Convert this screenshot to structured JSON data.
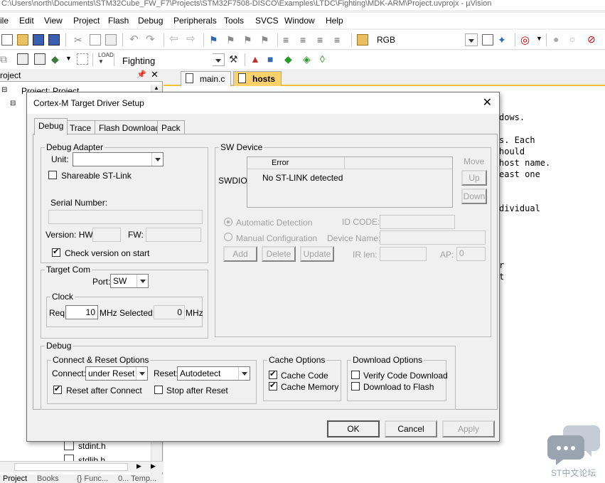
{
  "window": {
    "title": "C:\\Users\\north\\Documents\\STM32Cube_FW_F7\\Projects\\STM32F7508-DISCO\\Examples\\LTDC\\Fighting\\MDK-ARM\\Project.uvprojx - µVision"
  },
  "menu": [
    "ile",
    "Edit",
    "View",
    "Project",
    "Flash",
    "Debug",
    "Peripherals",
    "Tools",
    "SVCS",
    "Window",
    "Help"
  ],
  "toolbar": {
    "rgb_label": "RGB",
    "target_value": "Fighting"
  },
  "project_panel": {
    "title": "roject",
    "root": "Project: Project",
    "files": [
      "stdint.h",
      "stdlib.h"
    ],
    "bottom_tabs": [
      "Project",
      "Books",
      "{} Func...",
      "0... Temp..."
    ]
  },
  "editor": {
    "tabs": [
      "main.c",
      "hosts"
    ],
    "lines": [
      "dows.",
      "s. Each",
      "hould",
      "host name.",
      "east one",
      "dividual",
      "r",
      "t"
    ]
  },
  "dialog": {
    "title": "Cortex-M Target Driver Setup",
    "tabs": [
      "Debug",
      "Trace",
      "Flash Download",
      "Pack"
    ],
    "debug_adapter": {
      "legend": "Debug Adapter",
      "unit_label": "Unit:",
      "unit_value": "",
      "shareable_label": "Shareable ST-Link",
      "serial_label": "Serial Number:",
      "serial_value": "",
      "version_hw_label": "Version: HW:",
      "hw_value": "",
      "fw_label": "FW:",
      "fw_value": "",
      "check_version_label": "Check version on start"
    },
    "target_com": {
      "legend": "Target Com",
      "port_label": "Port:",
      "port_value": "SW",
      "clock_legend": "Clock",
      "req_label": "Req:",
      "req_value": "10",
      "mhz1": "MHz",
      "selected_label": "Selected:",
      "selected_value": "0",
      "mhz2": "MHz"
    },
    "sw_device": {
      "legend": "SW Device",
      "column_error": "Error",
      "row_label": "SWDIO",
      "row_error": "No ST-LINK detected",
      "move_label": "Move",
      "up_label": "Up",
      "down_label": "Down",
      "auto_detect_label": "Automatic Detection",
      "manual_config_label": "Manual Configuration",
      "id_code_label": "ID CODE:",
      "device_name_label": "Device Name:",
      "ir_len_label": "IR len:",
      "ap_label": "AP:",
      "ap_value": "0",
      "add_label": "Add",
      "delete_label": "Delete",
      "update_label": "Update"
    },
    "debug": {
      "legend": "Debug",
      "connect_reset_legend": "Connect & Reset Options",
      "connect_label": "Connect:",
      "connect_value": "under Reset",
      "reset_label": "Reset:",
      "reset_value": "Autodetect",
      "reset_after_connect_label": "Reset after Connect",
      "stop_after_reset_label": "Stop after Reset",
      "cache_legend": "Cache Options",
      "cache_code_label": "Cache Code",
      "cache_memory_label": "Cache Memory",
      "download_legend": "Download Options",
      "verify_label": "Verify Code Download",
      "download_flash_label": "Download to Flash"
    },
    "buttons": {
      "ok": "OK",
      "cancel": "Cancel",
      "apply": "Apply"
    }
  },
  "watermark": {
    "text": "ST中文论坛"
  },
  "colors": {
    "accent": "#0078d7",
    "active_tab": "#fbd26a"
  }
}
